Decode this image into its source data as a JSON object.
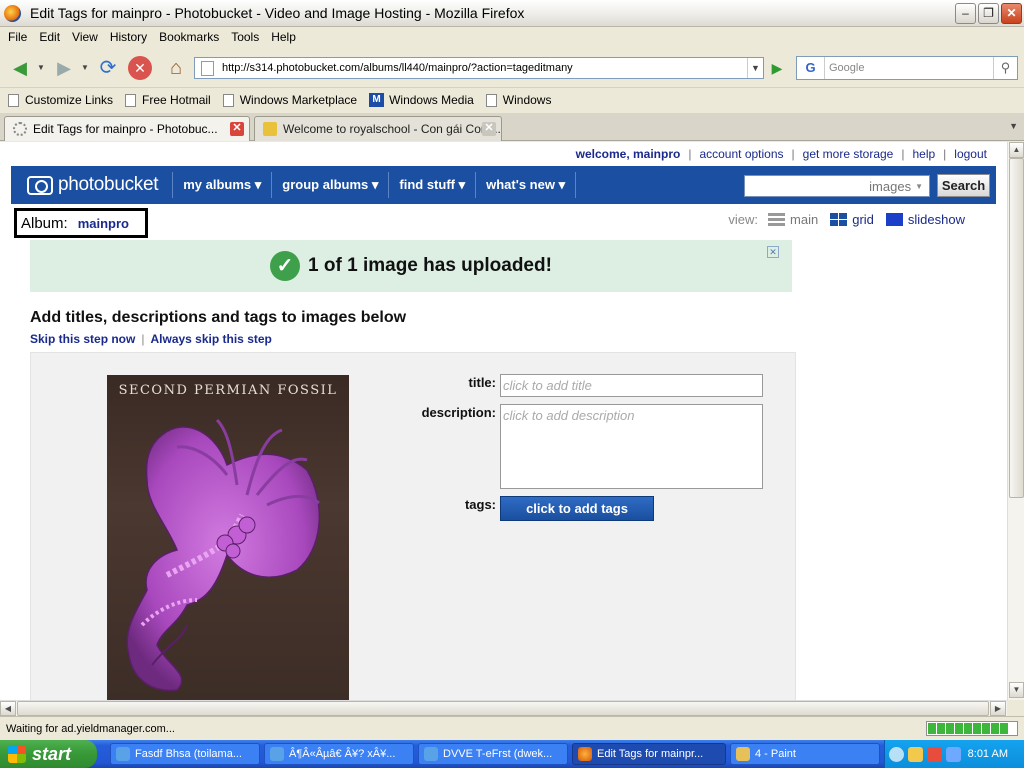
{
  "window": {
    "title": "Edit Tags for mainpro - Photobucket - Video and Image Hosting - Mozilla Firefox",
    "min_icon": "minimize-icon",
    "max_icon": "restore-icon",
    "close_icon": "close-icon"
  },
  "menu": [
    "File",
    "Edit",
    "View",
    "History",
    "Bookmarks",
    "Tools",
    "Help"
  ],
  "toolbar": {
    "url": "http://s314.photobucket.com/albums/ll440/mainpro/?action=tageditmany",
    "search_placeholder": "Google",
    "search_engine": "G"
  },
  "bookmarks": [
    "Customize Links",
    "Free Hotmail",
    "Windows Marketplace",
    "Windows Media",
    "Windows"
  ],
  "tabs": [
    {
      "label": "Edit Tags for mainpro - Photobuc...",
      "active": true
    },
    {
      "label": "Welcome to royalschool - Con gái Con ...",
      "active": false
    }
  ],
  "site": {
    "top_links": {
      "welcome": "welcome, mainpro",
      "account": "account options",
      "storage": "get more storage",
      "help": "help",
      "logout": "logout"
    },
    "logo": "photobucket",
    "nav": [
      "my albums",
      "group albums",
      "find stuff",
      "what's new"
    ],
    "search_option": "images",
    "search_button": "Search",
    "album_label": "Album:",
    "album_name": "mainpro",
    "view_label": "view:",
    "view_main": "main",
    "view_grid": "grid",
    "view_slideshow": "slideshow",
    "banner_message": "1 of 1 image has uploaded!",
    "heading": "Add titles, descriptions and tags to images below",
    "skip_now": "Skip this step now",
    "skip_always": "Always skip this step",
    "photo_caption": "SECOND PERMIAN FOSSIL",
    "title_label": "title:",
    "title_placeholder": "click to add title",
    "description_label": "description:",
    "description_placeholder": "click to add description",
    "tags_label": "tags:",
    "tags_button": "click to add tags"
  },
  "status": {
    "text": "Waiting for ad.yieldmanager.com...",
    "progress": 1.0
  },
  "taskbar": {
    "start": "start",
    "items": [
      {
        "label": "Fasdf Bhsa (toilama...",
        "active": false
      },
      {
        "label": "Â¶Â«Âµâ€ Â¥? xÂ¥...",
        "active": false
      },
      {
        "label": "DVVE T-eFrst (dwek...",
        "active": false
      },
      {
        "label": "Edit Tags for mainpr...",
        "active": true
      },
      {
        "label": "4 - Paint",
        "active": false
      }
    ],
    "clock": "8:01 AM"
  },
  "colors": {
    "pb_blue": "#1b4fa1",
    "link": "#1a2a8c",
    "banner_bg": "#dcefe2",
    "check_green": "#3ea04a",
    "fossil_purple": "#b356c9"
  }
}
